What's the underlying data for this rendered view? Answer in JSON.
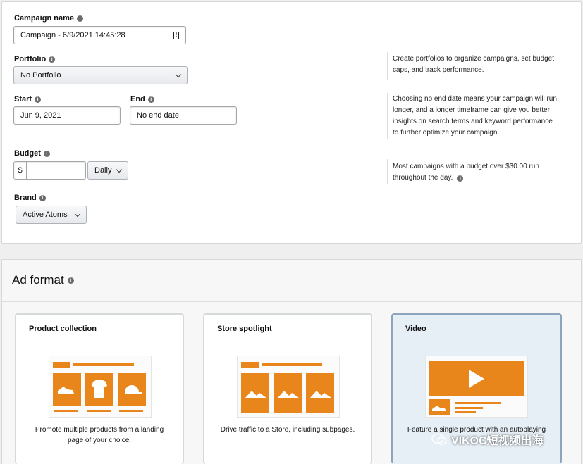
{
  "campaign": {
    "name_label": "Campaign name",
    "name_value": "Campaign - 6/9/2021 14:45:28",
    "portfolio_label": "Portfolio",
    "portfolio_value": "No Portfolio",
    "start_label": "Start",
    "start_value": "Jun 9, 2021",
    "end_label": "End",
    "end_value": "No end date",
    "budget_label": "Budget",
    "currency": "$",
    "budget_value": "",
    "budget_period": "Daily",
    "brand_label": "Brand",
    "brand_value": "Active Atoms"
  },
  "hints": {
    "portfolio": [
      "Create portfolios to organize campaigns, set budget",
      "caps, and track performance."
    ],
    "end_date": [
      "Choosing no end date means your campaign will run",
      "longer, and a longer timeframe can give you better",
      "insights on search terms and keyword performance",
      "to further optimize your campaign."
    ],
    "budget": [
      "Most campaigns with a budget over $30.00 run",
      "throughout the day."
    ]
  },
  "ad_format": {
    "title": "Ad format",
    "cards": [
      {
        "title": "Product collection",
        "desc": [
          "Promote multiple products from a landing",
          "page of your choice."
        ],
        "selected": false
      },
      {
        "title": "Store spotlight",
        "desc": [
          "Drive traffic to a Store, including subpages."
        ],
        "selected": false
      },
      {
        "title": "Video",
        "desc": [
          "Feature a single product with an autoplaying"
        ],
        "selected": true
      }
    ]
  },
  "watermark": "VIKOC短视频出海",
  "colors": {
    "accent": "#e9861b",
    "selected_bg": "#e6eef6"
  }
}
